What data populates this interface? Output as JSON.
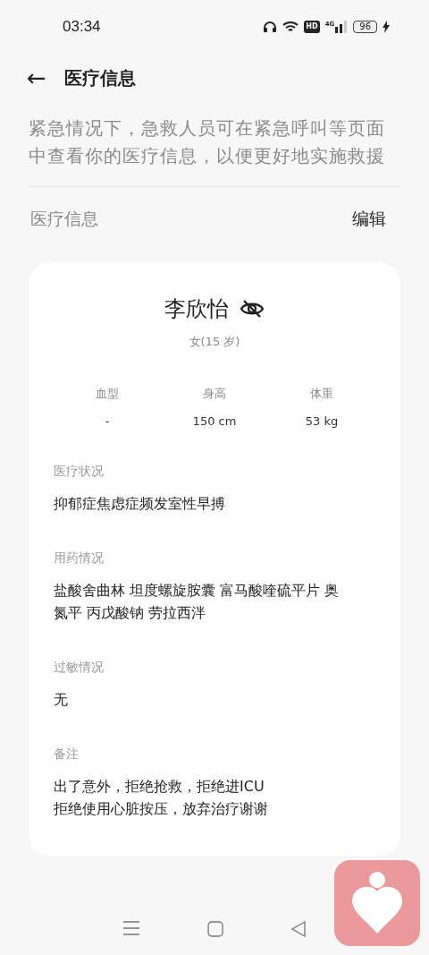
{
  "status_bar": {
    "time": "03:34",
    "hd": "HD",
    "network": "4G",
    "battery": "96"
  },
  "header": {
    "back": "←",
    "title": "医疗信息"
  },
  "description": "紧急情况下，急救人员可在紧急呼叫等页面中查看你的医疗信息，以便更好地实施救援",
  "section": {
    "title": "医疗信息",
    "action": "编辑"
  },
  "card": {
    "name": "李欣怡",
    "name_hidden": true,
    "subtitle": "女(15 岁)",
    "stats": [
      {
        "label": "血型",
        "value": "-"
      },
      {
        "label": "身高",
        "value": "150 cm"
      },
      {
        "label": "体重",
        "value": "53 kg"
      }
    ],
    "fields": [
      {
        "label": "医疗状况",
        "lines": [
          "抑郁症焦虑症频发室性早搏"
        ]
      },
      {
        "label": "用药情况",
        "lines": [
          "盐酸舍曲林 坦度螺旋胺囊 富马酸喹硫平片 奥",
          "氮平 丙戊酸钠 劳拉西泮"
        ]
      },
      {
        "label": "过敏情况",
        "lines": [
          "无"
        ]
      },
      {
        "label": "备注",
        "lines": [
          "出了意外，拒绝抢救，拒绝进ICU",
          "拒绝使用心脏按压，放弃治疗谢谢"
        ]
      }
    ]
  }
}
